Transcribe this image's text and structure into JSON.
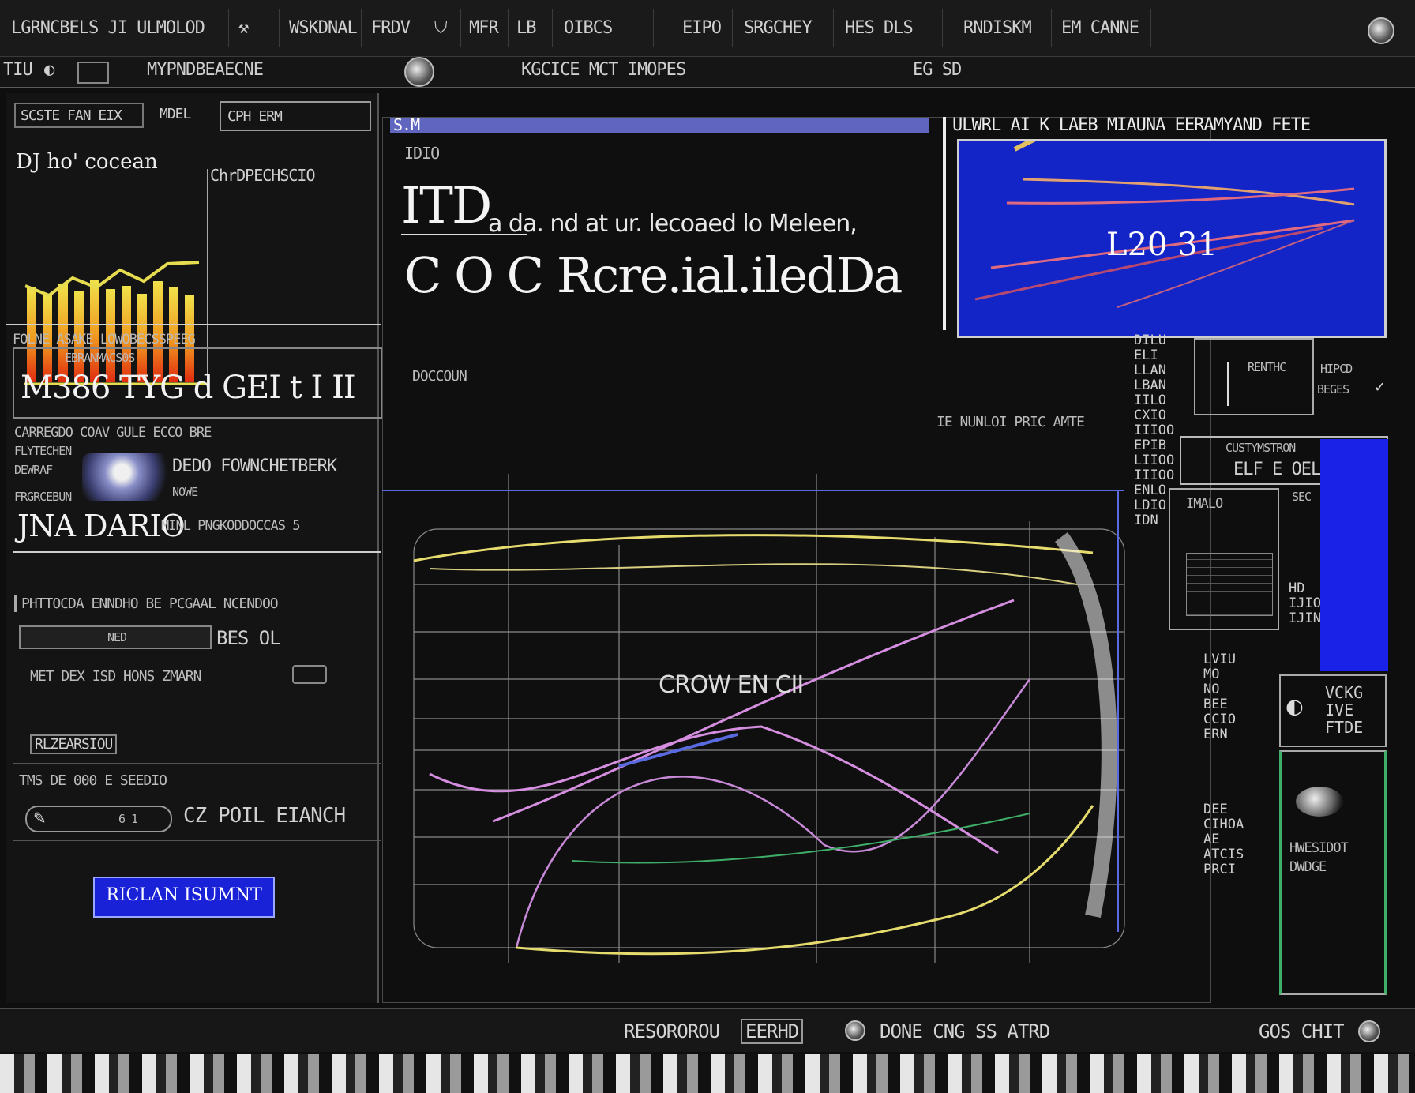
{
  "menubar": {
    "items": [
      {
        "label": "LGRNCBELS JI ULMOLOD"
      },
      {
        "label": "WSKDNAL"
      },
      {
        "label": "FRDV"
      },
      {
        "label": "MFR"
      },
      {
        "label": "LB"
      },
      {
        "label": "OIBCS"
      },
      {
        "label": "EIPO"
      },
      {
        "label": "SRGCHEY"
      },
      {
        "label": "HES DLS"
      },
      {
        "label": "RNDISKM"
      },
      {
        "label": "EM CANNE"
      }
    ]
  },
  "toolbar": {
    "left_label": "TIU",
    "path_text": "MYPNDBEAECNE",
    "center_text": "KGCICE MCT IMOPES",
    "right_text": "EG SD"
  },
  "left_panel": {
    "tabs": [
      "SCSTE FAN EIX",
      "MDEL"
    ],
    "search_value": "CPH ERM",
    "ocean_label": "DJ ho' cocean",
    "side_label": "ChrDPECHSCIO",
    "section1_title": "FOLNE ASAKE LOWOBECSSPEEG",
    "section1_sub": "EBRANMACS0S",
    "big_code": "M386 TYG d GEI t I II",
    "row1": "CARREGDO COAV GULE ECCO BRE",
    "row2_label_a": "FLYTECHEN",
    "row2_label_b": "DEWRAF",
    "row2_label_c": "FRGRCEBUN",
    "profile_name": "DEDO FOWNCHETBERK",
    "profile_sub": "NOWE",
    "big_code2": "JNA DARIO",
    "big_code2_tail": "MINL PNGKODDOCCAS 5",
    "row3": "PHTTOCDA ENNDHO BE PCGAAL NCENDOO",
    "field_value": "NED",
    "field_suffix": "BES OL",
    "row4": "MET DEX ISD HONS ZMARN",
    "tag": "RLZEARSIOU",
    "row5": "TMS DE 000 E SEEDIO",
    "row6_field": "6 1",
    "row6_suffix": "CZ POIL EIANCH",
    "primary_button": "RICLAN ISUMNT"
  },
  "center": {
    "small_tag": "IDIO",
    "headline_prefix": "ITD",
    "headline_words": "a da.  nd at ur.  lecoaed  lo Meleen,",
    "headline_big": "C O C Rcre.ial.iledDa",
    "label_doc": "DOCCOUN",
    "mid_label": "IE NUNLOI PRIC AMTE",
    "chart_label": "CROW EN CII"
  },
  "preview": {
    "title": "ULWRL AI K LAEB MIAUNA EERAMYAND FETE",
    "value": "L20 31"
  },
  "right_column": {
    "vlist1": "DILU\nELI\nLLAN\nLBAN\nIILO\nCXIO\nIIIOO\nEPIB\nLIIOO\nIIIOO\nENLO\nLDIO\nIDN",
    "box_label": "RENTHC",
    "box_side1": "HIPCD",
    "box_side2": "BEGES",
    "card_title": "CUSTYMSTRON",
    "card_value": "ELF E OEL",
    "card_sub": "IMALO",
    "card_sub2": "SEC",
    "vlist2": "HD\nIJIO\nIJIN",
    "vlist3": "LVIU\nMO\nNO\nBEE\nCCIO\nERN",
    "vlist4": "DEE\nCIHOA\nAE\nATCIS\nPRCI",
    "side_block": "VCKG\nIVE\nFTDE",
    "bottom_card_title": "HWESIDOT",
    "bottom_card_sub": "DWDGE"
  },
  "statusbar": {
    "left": "RESOROROU",
    "mid_boxed": "EERHD",
    "center": "DONE CNG SS ATRD",
    "right": "GOS CHIT"
  },
  "colors": {
    "accent_blue": "#1a22e8",
    "chart_yellow": "#e6dc6e",
    "chart_pink": "#d58ee0",
    "chart_blue": "#5a6ae0",
    "chart_green": "#3fae68"
  }
}
